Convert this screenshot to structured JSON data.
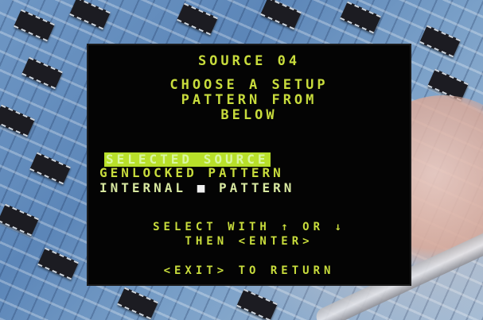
{
  "screen": {
    "title": "SOURCE 04",
    "instruction_lines": [
      "CHOOSE A SETUP",
      "PATTERN FROM",
      "BELOW"
    ],
    "options": [
      {
        "label": "SELECTED SOURCE",
        "selected": true
      },
      {
        "label": "GENLOCKED PATTERN",
        "selected": false
      },
      {
        "label_prefix": "INTERNAL",
        "glyph": "■",
        "label_suffix": "PATTERN",
        "selected": false
      }
    ],
    "help": {
      "select_prefix": "SELECT WITH",
      "arrow_up": "↑",
      "or_word": "OR",
      "arrow_down": "↓",
      "then_line": "THEN <ENTER>",
      "exit_line": "<EXIT> TO RETURN"
    },
    "colors": {
      "text": "#c8dc3c",
      "highlight": "#b8e02a",
      "screen_bg": "#040404"
    }
  }
}
